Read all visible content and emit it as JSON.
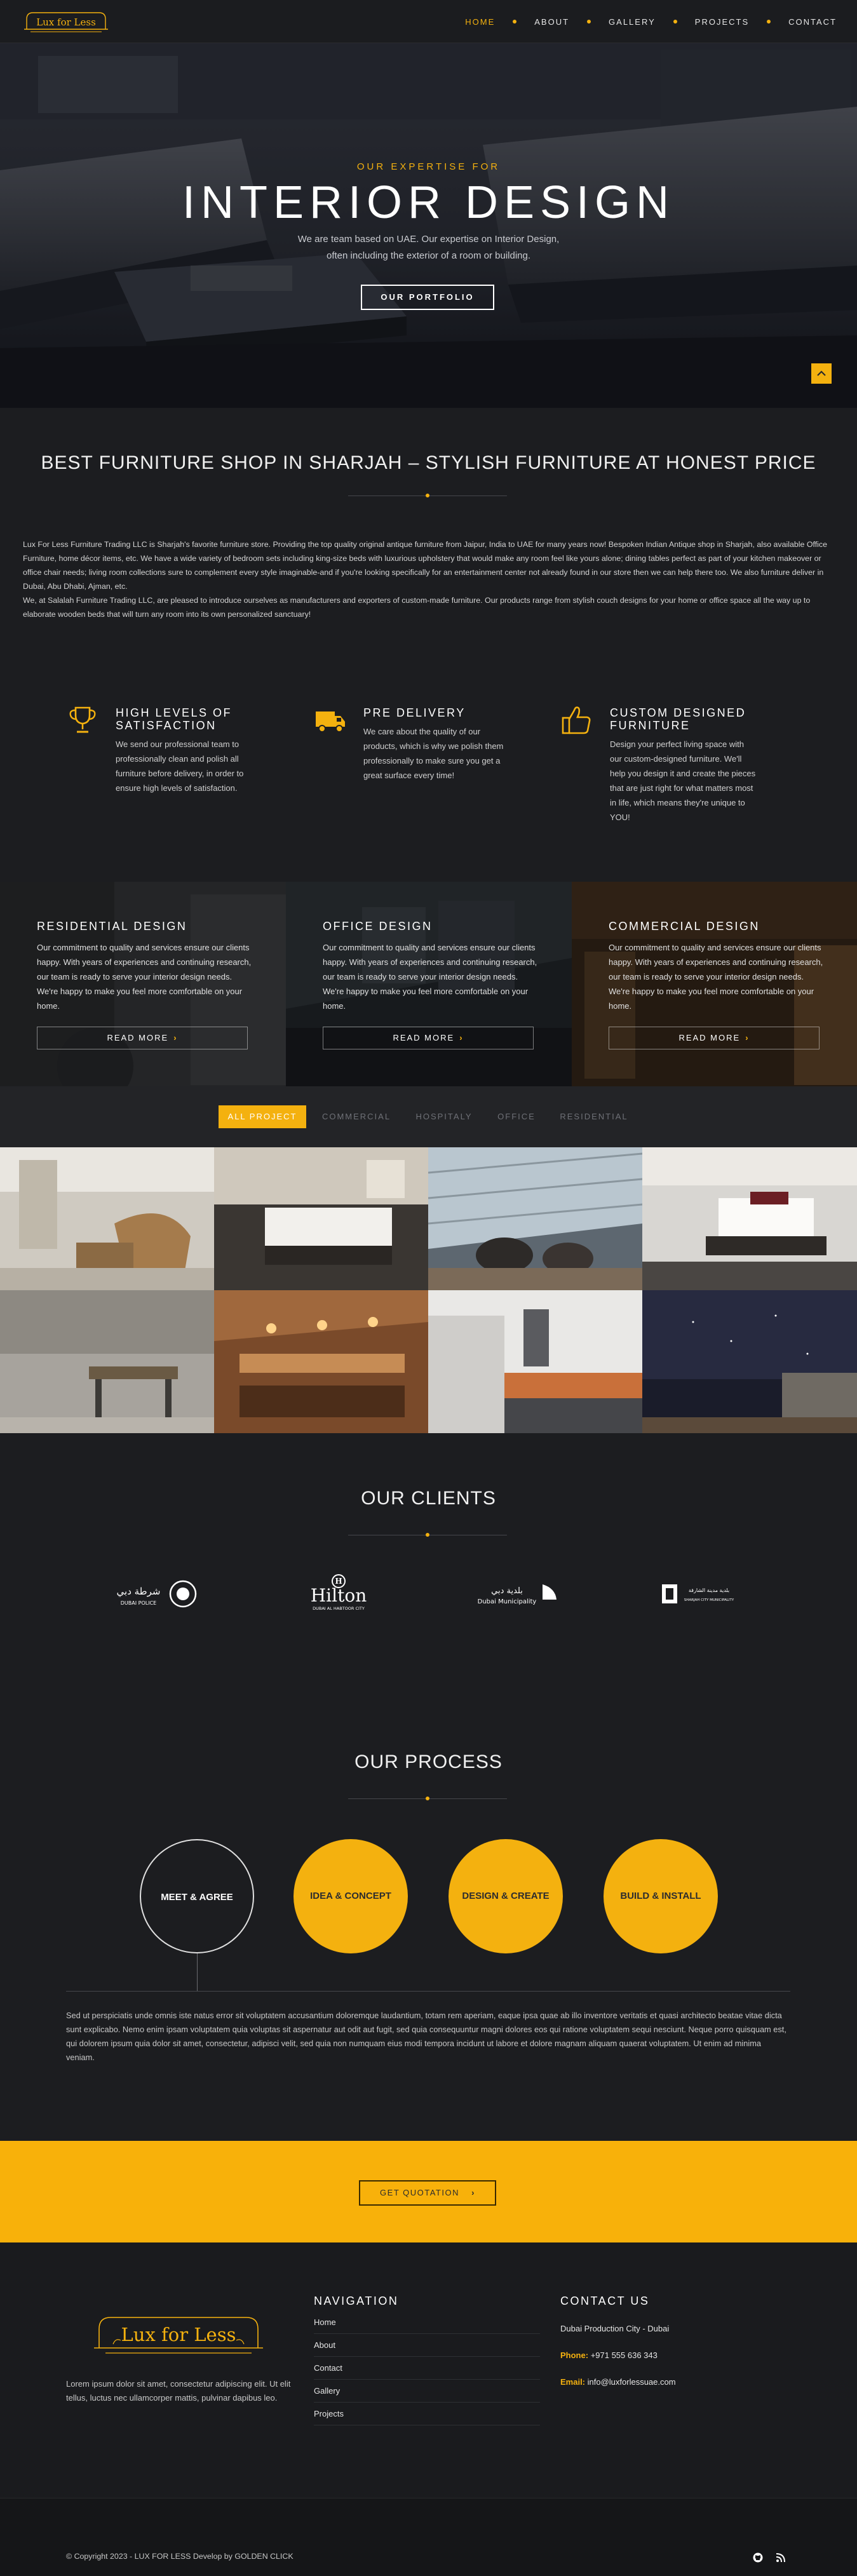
{
  "nav": {
    "logo_text": "Lux for Less",
    "items": [
      {
        "label": "HOME",
        "active": true
      },
      {
        "label": "ABOUT",
        "active": false
      },
      {
        "label": "GALLERY",
        "active": false
      },
      {
        "label": "PROJECTS",
        "active": false
      },
      {
        "label": "CONTACT",
        "active": false
      }
    ]
  },
  "hero": {
    "eyebrow": "OUR EXPERTISE FOR",
    "title": "INTERIOR DESIGN",
    "subtitle_line1": "We are team based on UAE. Our expertise on Interior Design,",
    "subtitle_line2": "often including the exterior of a room or building.",
    "button": "OUR PORTFOLIO",
    "scroll_icon": "chevron-up-icon"
  },
  "intro": {
    "title": "BEST FURNITURE SHOP IN SHARJAH – STYLISH FURNITURE AT HONEST PRICE",
    "paragraph1": "Lux For Less Furniture Trading LLC is Sharjah's favorite furniture store. Providing the top quality original antique furniture from Jaipur, India to UAE for many years now! Bespoken Indian Antique shop in Sharjah, also available Office Furniture, home décor items, etc. We have a wide variety of bedroom sets including king-size beds with luxurious upholstery that would make any room feel like yours alone; dining tables perfect as part of your kitchen makeover or office chair needs; living room collections sure to complement every style imaginable-and if you're looking specifically for an entertainment center not already found in our store then we can help there too. We also furniture deliver in Dubai, Abu Dhabi, Ajman, etc.",
    "paragraph2": "We, at Salalah Furniture Trading LLC, are pleased to introduce ourselves as manufacturers and exporters of custom-made furniture. Our products range from stylish couch designs for your home or office space all the way up to elaborate wooden beds that will turn any room into its own personalized sanctuary!"
  },
  "features": [
    {
      "icon": "trophy-icon",
      "title_line1": "HIGH LEVELS OF",
      "title_line2": "SATISFACTION",
      "text": "We send our professional team to professionally clean and polish all furniture before delivery, in order to ensure high levels of satisfaction."
    },
    {
      "icon": "delivery-truck-icon",
      "title_line1": "PRE DELIVERY",
      "title_line2": "",
      "text": "We care about the quality of our products, which is why we polish them professionally to make sure you get a great surface every time!"
    },
    {
      "icon": "thumbs-up-icon",
      "title_line1": "CUSTOM DESIGNED",
      "title_line2": "FURNITURE",
      "text": "Design your perfect living space with our custom-designed furniture. We'll help you design it and create the pieces that are just right for what matters most in life, which means they're unique to YOU!"
    }
  ],
  "panels": [
    {
      "title": "RESIDENTIAL DESIGN",
      "text": "Our commitment to quality and services ensure our clients happy. With years of experiences and continuing research, our team is ready to serve your interior design needs. We're happy to make you feel more comfortable on your home.",
      "button": "READ MORE"
    },
    {
      "title": "OFFICE DESIGN",
      "text": "Our commitment to quality and services ensure our clients happy. With years of experiences and continuing research, our team is ready to serve your interior design needs. We're happy to make you feel more comfortable on your home.",
      "button": "READ MORE"
    },
    {
      "title": "COMMERCIAL DESIGN",
      "text": "Our commitment to quality and services ensure our clients happy. With years of experiences and continuing research, our team is ready to serve your interior design needs. We're happy to make you feel more comfortable on your home.",
      "button": "READ MORE"
    }
  ],
  "filters": [
    "ALL PROJECT",
    "COMMERCIAL",
    "HOSPITALY",
    "OFFICE",
    "RESIDENTIAL"
  ],
  "clients": {
    "title": "OUR CLIENTS",
    "logos": [
      {
        "name": "dubai-police",
        "text_ar": "شرطة دبي",
        "text": "DUBAI POLICE"
      },
      {
        "name": "hilton",
        "text": "Hilton",
        "sub": "DUBAI AL HABTOOR CITY"
      },
      {
        "name": "dubai-municipality",
        "text_ar": "بلدية دبي",
        "text": "Dubai Municipality"
      },
      {
        "name": "sharjah-city-municipality",
        "text_ar": "بلدية مدينة الشارقة",
        "text": "SHARJAH CITY MUNICIPALITY"
      }
    ]
  },
  "process": {
    "title": "OUR PROCESS",
    "steps": [
      "MEET & AGREE",
      "IDEA & CONCEPT",
      "DESIGN & CREATE",
      "BUILD & INSTALL"
    ],
    "text": "Sed ut perspiciatis unde omnis iste natus error sit voluptatem accusantium doloremque laudantium, totam rem aperiam, eaque ipsa quae ab illo inventore veritatis et quasi architecto beatae vitae dicta sunt explicabo. Nemo enim ipsam voluptatem quia voluptas sit aspernatur aut odit aut fugit, sed quia consequuntur magni dolores eos qui ratione voluptatem sequi nesciunt. Neque porro quisquam est, qui dolorem ipsum quia dolor sit amet, consectetur, adipisci velit, sed quia non numquam eius modi tempora incidunt ut labore et dolore magnam aliquam quaerat voluptatem. Ut enim ad minima veniam."
  },
  "cta": {
    "button": "GET QUOTATION"
  },
  "footer": {
    "logo_text": "Lux for Less",
    "about": "Lorem ipsum dolor sit amet, consectetur adipiscing elit. Ut elit tellus, luctus nec ullamcorper mattis, pulvinar dapibus leo.",
    "nav_title": "NAVIGATION",
    "nav_links": [
      "Home",
      "About",
      "Contact",
      "Gallery",
      "Projects"
    ],
    "contact_title": "CONTACT US",
    "address": "Dubai Production City - Dubai",
    "phone_label": "Phone:",
    "phone": "+971 555 636 343",
    "email_label": "Email:",
    "email": "info@luxforlessuae.com",
    "copyright": "© Copyright 2023 - LUX FOR LESS Develop by GOLDEN CLICK",
    "social_icons": [
      "github-icon",
      "rss-icon"
    ]
  },
  "colors": {
    "accent": "#f4b10f",
    "background": "#1c1d20",
    "cta_background": "#f8b10a"
  }
}
